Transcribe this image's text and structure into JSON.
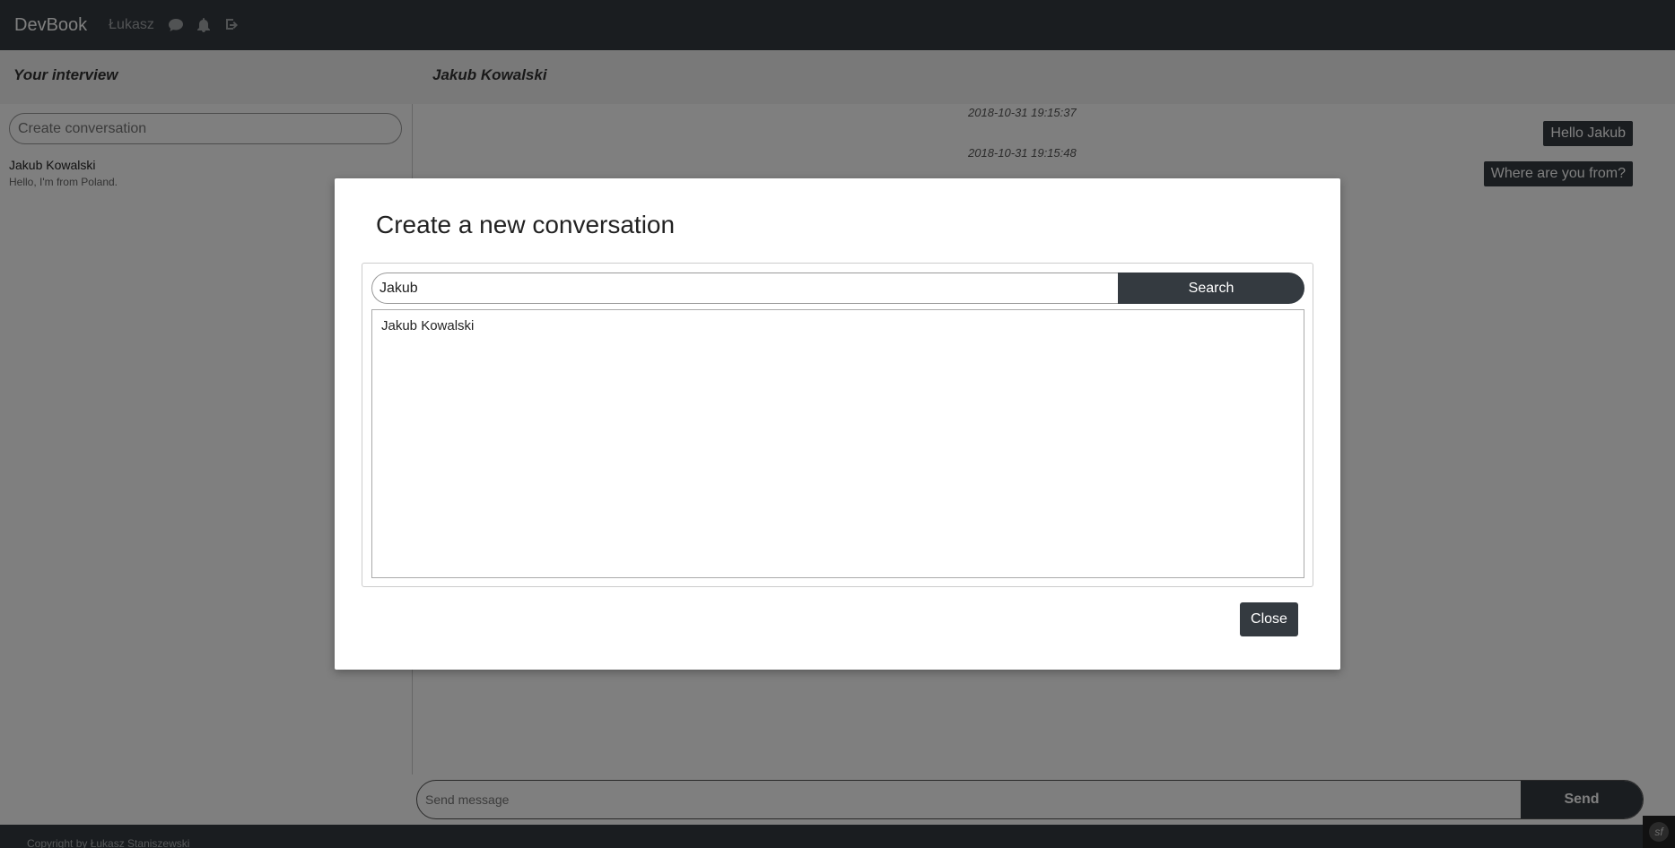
{
  "navbar": {
    "brand": "DevBook",
    "user": "Łukasz",
    "icons": [
      "comment-icon",
      "bell-icon",
      "sign-out-icon"
    ]
  },
  "sidebar": {
    "title": "Your interview",
    "create_placeholder": "Create conversation",
    "conversations": [
      {
        "name": "Jakub Kowalski",
        "preview": "Hello, I'm from Poland."
      }
    ]
  },
  "chat": {
    "title": "Jakub Kowalski",
    "messages": [
      {
        "time": "2018-10-31 19:15:37",
        "text": "Hello Jakub"
      },
      {
        "time": "2018-10-31 19:15:48",
        "text": "Where are you from?"
      }
    ],
    "send_placeholder": "Send message",
    "send_label": "Send"
  },
  "footer": {
    "copyright": "Copyright by Łukasz Staniszewski"
  },
  "modal": {
    "title": "Create a new conversation",
    "search_value": "Jakub",
    "search_label": "Search",
    "results": [
      "Jakub Kowalski"
    ],
    "close_label": "Close"
  },
  "colors": {
    "dark": "#343a40",
    "overlay": "rgba(0,0,0,0.5)"
  }
}
